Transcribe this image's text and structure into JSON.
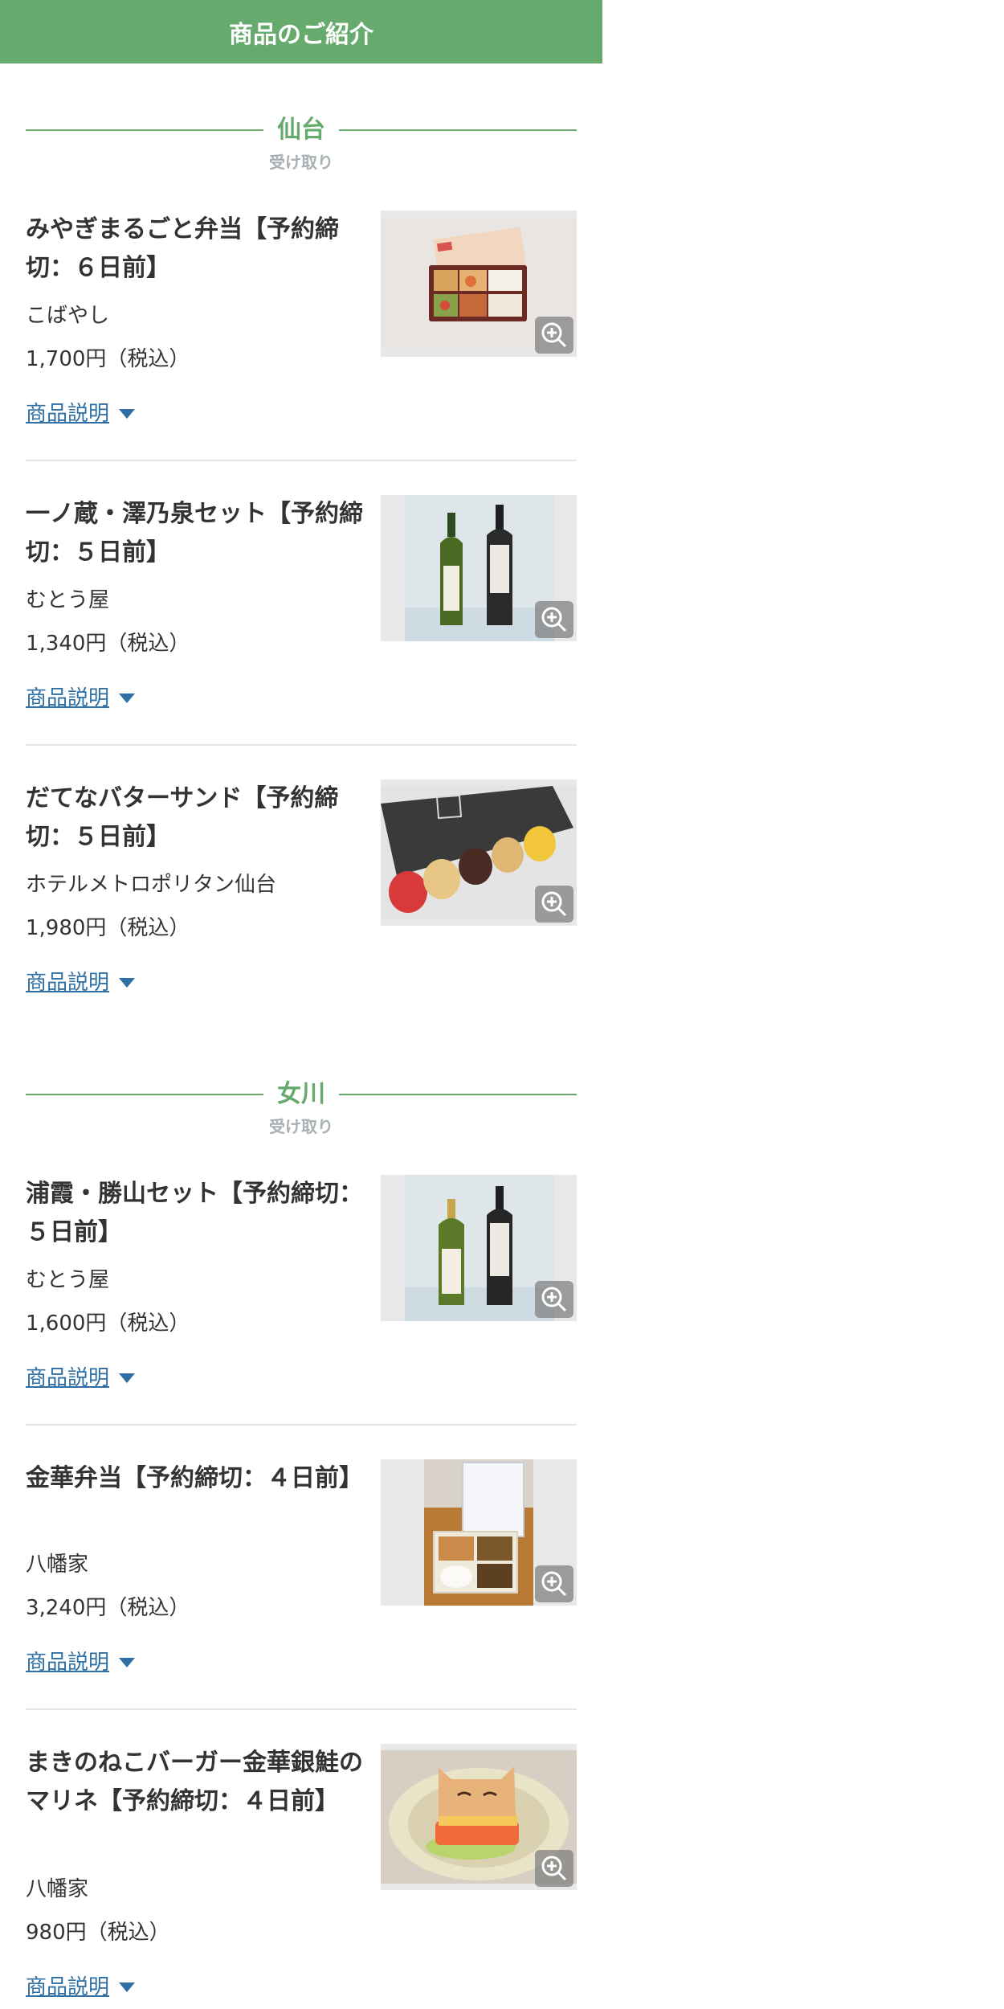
{
  "header": {
    "title": "商品のご紹介"
  },
  "sections": [
    {
      "title": "仙台",
      "subtitle": "受け取り",
      "items": [
        {
          "title": "みやぎまるごと弁当【予約締切：６日前】",
          "shop": "こばやし",
          "price": "1,700円（税込）",
          "desc_label": "商品説明",
          "image": "bento-box"
        },
        {
          "title": "一ノ蔵・澤乃泉セット【予約締切：５日前】",
          "shop": "むとう屋",
          "price": "1,340円（税込）",
          "desc_label": "商品説明",
          "image": "sake-bottles"
        },
        {
          "title": "だてなバターサンド【予約締切：５日前】",
          "shop": "ホテルメトロポリタン仙台",
          "price": "1,980円（税込）",
          "desc_label": "商品説明",
          "image": "butter-sand"
        }
      ]
    },
    {
      "title": "女川",
      "subtitle": "受け取り",
      "items": [
        {
          "title": "浦霞・勝山セット【予約締切：５日前】",
          "shop": "むとう屋",
          "price": "1,600円（税込）",
          "desc_label": "商品説明",
          "image": "sake-bottles"
        },
        {
          "title": "金華弁当【予約締切：４日前】",
          "shop": "八幡家",
          "price": "3,240円（税込）",
          "desc_label": "商品説明",
          "image": "kinka-bento"
        },
        {
          "title": "まきのねこバーガー金華銀鮭のマリネ【予約締切：４日前】",
          "shop": "八幡家",
          "price": "980円（税込）",
          "desc_label": "商品説明",
          "image": "cat-burger"
        }
      ]
    }
  ],
  "colors": {
    "accent": "#67aa6e",
    "link": "#2f6fa3",
    "subtitle": "#a8b0b3"
  },
  "icons": {
    "zoom": "zoom-in-icon",
    "expand": "caret-down-icon"
  }
}
